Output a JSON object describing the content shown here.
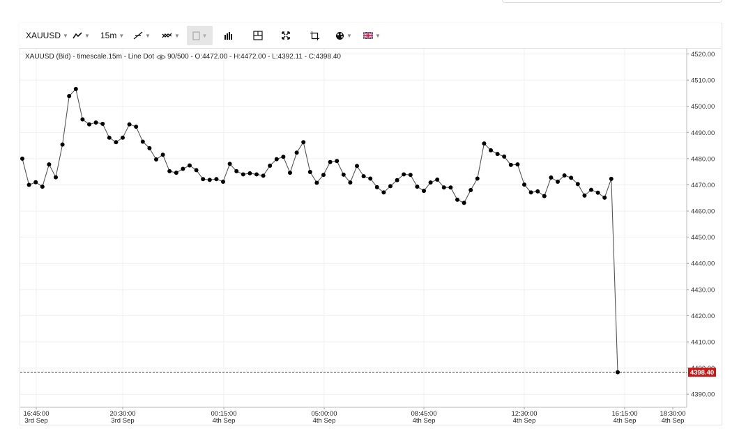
{
  "toolbar": {
    "symbol": "XAUUSD",
    "interval": "15m",
    "items": [
      {
        "name": "line-type-icon"
      },
      {
        "name": "trendline-icon"
      },
      {
        "name": "indicators-icon"
      },
      {
        "name": "drawing-tool-icon"
      },
      {
        "name": "volume-bars-icon"
      },
      {
        "name": "crosshair-layout-icon"
      },
      {
        "name": "fullscreen-icon"
      },
      {
        "name": "crop-icon"
      },
      {
        "name": "color-palette-icon"
      },
      {
        "name": "uk-flag-icon"
      }
    ]
  },
  "legend": {
    "instrument": "XAUUSD (Bid) - timescale.15m - Line Dot",
    "bars": "90/500",
    "ohlc": "- O:4472.00 - H:4472.00 - L:4392.11 - C:4398.40"
  },
  "last_price_label": "4398.40",
  "colors": {
    "line": "#555555",
    "dot": "#000000",
    "last_price_bg": "#c41a1a",
    "grid": "#efefef"
  },
  "chart_data": {
    "type": "line",
    "symbol": "XAUUSD",
    "ylim": [
      4385,
      4522
    ],
    "y_ticks": [
      "4520.00",
      "4510.00",
      "4500.00",
      "4490.00",
      "4480.00",
      "4470.00",
      "4460.00",
      "4450.00",
      "4440.00",
      "4430.00",
      "4420.00",
      "4410.00",
      "4400.00",
      "4390.00"
    ],
    "x_ticks": [
      {
        "time": "16:45:00",
        "date": "3rd Sep"
      },
      {
        "time": "20:30:00",
        "date": "3rd Sep"
      },
      {
        "time": "00:15:00",
        "date": "4th Sep"
      },
      {
        "time": "05:00:00",
        "date": "4th Sep"
      },
      {
        "time": "08:45:00",
        "date": "4th Sep"
      },
      {
        "time": "12:30:00",
        "date": "4th Sep"
      },
      {
        "time": "16:15:00",
        "date": "4th Sep"
      },
      {
        "time": "18:30:00",
        "date": "4th Sep"
      }
    ],
    "values": [
      4480.0,
      4470.0,
      4471.0,
      4469.3,
      4477.8,
      4472.9,
      4485.4,
      4503.9,
      4506.6,
      4495.0,
      4493.1,
      4493.8,
      4493.3,
      4488.0,
      4486.3,
      4488.0,
      4493.1,
      4492.2,
      4486.5,
      4484.0,
      4479.7,
      4481.5,
      4475.2,
      4474.6,
      4476.1,
      4477.4,
      4475.6,
      4472.2,
      4471.9,
      4472.2,
      4471.2,
      4478.0,
      4475.2,
      4474.0,
      4474.4,
      4474.0,
      4473.5,
      4477.3,
      4479.8,
      4480.7,
      4474.6,
      4482.3,
      4486.3,
      4474.9,
      4470.8,
      4473.8,
      4478.7,
      4479.1,
      4473.9,
      4470.9,
      4477.2,
      4473.3,
      4472.4,
      4469.1,
      4467.1,
      4469.5,
      4471.8,
      4474.0,
      4473.8,
      4469.3,
      4467.7,
      4470.9,
      4472.0,
      4469.0,
      4469.0,
      4464.3,
      4463.1,
      4468.0,
      4472.4,
      4485.8,
      4483.2,
      4481.8,
      4480.8,
      4477.6,
      4477.8,
      4470.1,
      4467.1,
      4467.5,
      4465.7,
      4472.8,
      4471.2,
      4473.6,
      4472.7,
      4470.3,
      4465.9,
      4468.1,
      4467.0,
      4465.1,
      4472.3,
      4398.4
    ],
    "last_value": 4398.4
  }
}
